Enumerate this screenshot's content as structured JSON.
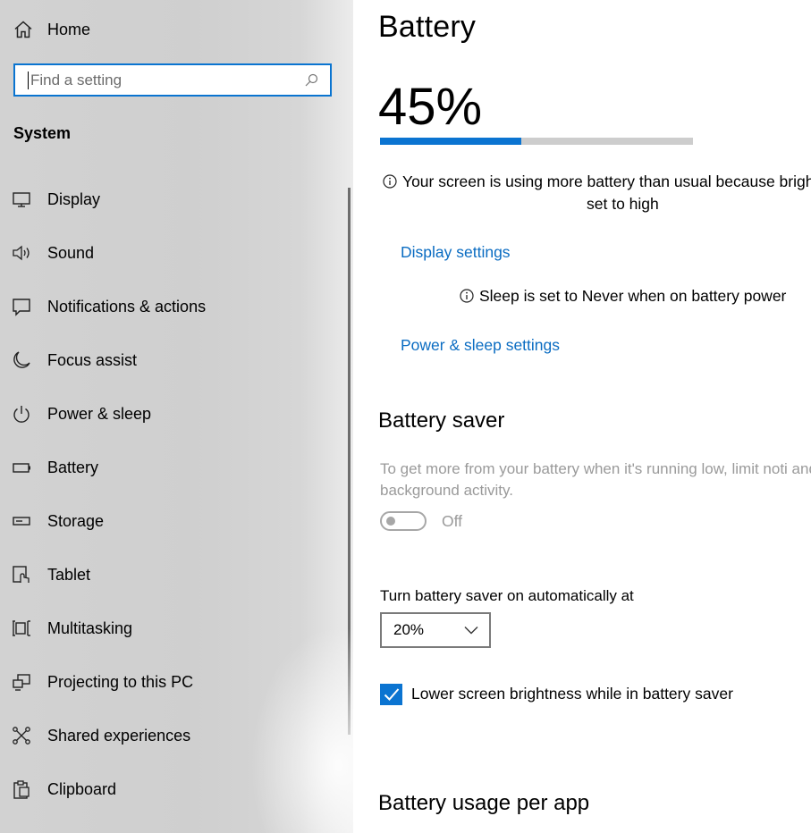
{
  "sidebar": {
    "home_label": "Home",
    "search_placeholder": "Find a setting",
    "section_title": "System",
    "items": [
      {
        "label": "Display",
        "icon": "display-icon"
      },
      {
        "label": "Sound",
        "icon": "sound-icon"
      },
      {
        "label": "Notifications & actions",
        "icon": "notifications-icon"
      },
      {
        "label": "Focus assist",
        "icon": "moon-icon"
      },
      {
        "label": "Power & sleep",
        "icon": "power-icon"
      },
      {
        "label": "Battery",
        "icon": "battery-icon"
      },
      {
        "label": "Storage",
        "icon": "storage-icon"
      },
      {
        "label": "Tablet",
        "icon": "tablet-icon"
      },
      {
        "label": "Multitasking",
        "icon": "multitasking-icon"
      },
      {
        "label": "Projecting to this PC",
        "icon": "projecting-icon"
      },
      {
        "label": "Shared experiences",
        "icon": "shared-experiences-icon"
      },
      {
        "label": "Clipboard",
        "icon": "clipboard-icon"
      }
    ]
  },
  "main": {
    "title": "Battery",
    "percent_text": "45%",
    "battery_level": 0.45,
    "brightness_notice_line1": "Your screen is using more battery than usual because brigh",
    "brightness_notice_line2": "set to high",
    "display_settings_link": "Display settings",
    "sleep_notice": "Sleep is set to Never when on battery power",
    "power_sleep_link": "Power & sleep settings",
    "battery_saver": {
      "heading": "Battery saver",
      "description": "To get more from your battery when it's running low, limit noti and background activity.",
      "toggle_state": "Off",
      "auto_label": "Turn battery saver on automatically at",
      "auto_value": "20%",
      "brightness_option": "Lower screen brightness while in battery saver",
      "brightness_checked": true
    },
    "usage_heading": "Battery usage per app"
  },
  "colors": {
    "accent": "#0b74d1",
    "link": "#0a6cc2",
    "disabled_text": "#9a9a9a"
  }
}
